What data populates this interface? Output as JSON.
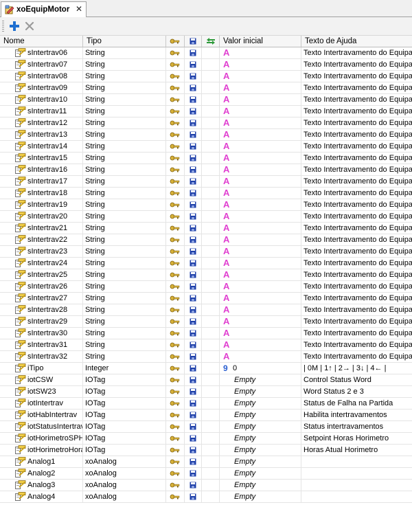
{
  "tab": {
    "title": "xoEquipMotor",
    "close": "✕",
    "icon": "object-type-icon"
  },
  "toolbar": {
    "add_label": "+",
    "remove_label": "✕"
  },
  "columns": {
    "nome": "Nome",
    "tipo": "Tipo",
    "valor": "Valor inicial",
    "ajuda": "Texto de Ajuda"
  },
  "colors": {
    "string_icon": "#e040d0",
    "integer_icon": "#2a5fd0",
    "save_icon": "#1e3fa8"
  },
  "rows": [
    {
      "name": "sIntertrav06",
      "type": "String",
      "kind": "string",
      "value": "",
      "help": "Texto Intertravamento do Equipa"
    },
    {
      "name": "sIntertrav07",
      "type": "String",
      "kind": "string",
      "value": "",
      "help": "Texto Intertravamento do Equipa"
    },
    {
      "name": "sIntertrav08",
      "type": "String",
      "kind": "string",
      "value": "",
      "help": "Texto Intertravamento do Equipa"
    },
    {
      "name": "sIntertrav09",
      "type": "String",
      "kind": "string",
      "value": "",
      "help": "Texto Intertravamento do Equipa"
    },
    {
      "name": "sIntertrav10",
      "type": "String",
      "kind": "string",
      "value": "",
      "help": "Texto Intertravamento do Equipa"
    },
    {
      "name": "sIntertrav11",
      "type": "String",
      "kind": "string",
      "value": "",
      "help": "Texto Intertravamento do Equipa"
    },
    {
      "name": "sIntertrav12",
      "type": "String",
      "kind": "string",
      "value": "",
      "help": "Texto Intertravamento do Equipa"
    },
    {
      "name": "sIntertrav13",
      "type": "String",
      "kind": "string",
      "value": "",
      "help": "Texto Intertravamento do Equipa"
    },
    {
      "name": "sIntertrav14",
      "type": "String",
      "kind": "string",
      "value": "",
      "help": "Texto Intertravamento do Equipa"
    },
    {
      "name": "sIntertrav15",
      "type": "String",
      "kind": "string",
      "value": "",
      "help": "Texto Intertravamento do Equipa"
    },
    {
      "name": "sIntertrav16",
      "type": "String",
      "kind": "string",
      "value": "",
      "help": "Texto Intertravamento do Equipa"
    },
    {
      "name": "sIntertrav17",
      "type": "String",
      "kind": "string",
      "value": "",
      "help": "Texto Intertravamento do Equipa"
    },
    {
      "name": "sIntertrav18",
      "type": "String",
      "kind": "string",
      "value": "",
      "help": "Texto Intertravamento do Equipa"
    },
    {
      "name": "sIntertrav19",
      "type": "String",
      "kind": "string",
      "value": "",
      "help": "Texto Intertravamento do Equipa"
    },
    {
      "name": "sIntertrav20",
      "type": "String",
      "kind": "string",
      "value": "",
      "help": "Texto Intertravamento do Equipa"
    },
    {
      "name": "sIntertrav21",
      "type": "String",
      "kind": "string",
      "value": "",
      "help": "Texto Intertravamento do Equipa"
    },
    {
      "name": "sIntertrav22",
      "type": "String",
      "kind": "string",
      "value": "",
      "help": "Texto Intertravamento do Equipa"
    },
    {
      "name": "sIntertrav23",
      "type": "String",
      "kind": "string",
      "value": "",
      "help": "Texto Intertravamento do Equipa"
    },
    {
      "name": "sIntertrav24",
      "type": "String",
      "kind": "string",
      "value": "",
      "help": "Texto Intertravamento do Equipa"
    },
    {
      "name": "sIntertrav25",
      "type": "String",
      "kind": "string",
      "value": "",
      "help": "Texto Intertravamento do Equipa"
    },
    {
      "name": "sIntertrav26",
      "type": "String",
      "kind": "string",
      "value": "",
      "help": "Texto Intertravamento do Equipa"
    },
    {
      "name": "sIntertrav27",
      "type": "String",
      "kind": "string",
      "value": "",
      "help": "Texto Intertravamento do Equipa"
    },
    {
      "name": "sIntertrav28",
      "type": "String",
      "kind": "string",
      "value": "",
      "help": "Texto Intertravamento do Equipa"
    },
    {
      "name": "sIntertrav29",
      "type": "String",
      "kind": "string",
      "value": "",
      "help": "Texto Intertravamento do Equipa"
    },
    {
      "name": "sIntertrav30",
      "type": "String",
      "kind": "string",
      "value": "",
      "help": "Texto Intertravamento do Equipa"
    },
    {
      "name": "sIntertrav31",
      "type": "String",
      "kind": "string",
      "value": "",
      "help": "Texto Intertravamento do Equipa"
    },
    {
      "name": "sIntertrav32",
      "type": "String",
      "kind": "string",
      "value": "",
      "help": "Texto Intertravamento do Equipa"
    },
    {
      "name": "iTipo",
      "type": "Integer",
      "kind": "integer",
      "value": "0",
      "help": "| 0M | 1↑ | 2→ | 3↓ | 4← |"
    },
    {
      "name": "iotCSW",
      "type": "IOTag",
      "kind": "object",
      "value": "Empty",
      "help": "Control Status Word"
    },
    {
      "name": "iotSW23",
      "type": "IOTag",
      "kind": "object",
      "value": "Empty",
      "help": "Word Status 2 e 3"
    },
    {
      "name": "iotIntertrav",
      "type": "IOTag",
      "kind": "object",
      "value": "Empty",
      "help": "Status de Falha na Partida"
    },
    {
      "name": "iotHabIntertrav",
      "type": "IOTag",
      "kind": "object",
      "value": "Empty",
      "help": "Habilita intertravamentos"
    },
    {
      "name": "iotStatusIntertrav",
      "type": "IOTag",
      "kind": "object",
      "value": "Empty",
      "help": "Status intertravamentos"
    },
    {
      "name": "iotHorimetroSPHoras",
      "type": "IOTag",
      "kind": "object",
      "value": "Empty",
      "help": "Setpoint Horas Horimetro"
    },
    {
      "name": "iotHorimetroHoras",
      "type": "IOTag",
      "kind": "object",
      "value": "Empty",
      "help": "Horas Atual Horimetro"
    },
    {
      "name": "Analog1",
      "type": "xoAnalog",
      "kind": "object",
      "value": "Empty",
      "help": ""
    },
    {
      "name": "Analog2",
      "type": "xoAnalog",
      "kind": "object",
      "value": "Empty",
      "help": ""
    },
    {
      "name": "Analog3",
      "type": "xoAnalog",
      "kind": "object",
      "value": "Empty",
      "help": ""
    },
    {
      "name": "Analog4",
      "type": "xoAnalog",
      "kind": "object",
      "value": "Empty",
      "help": ""
    }
  ]
}
